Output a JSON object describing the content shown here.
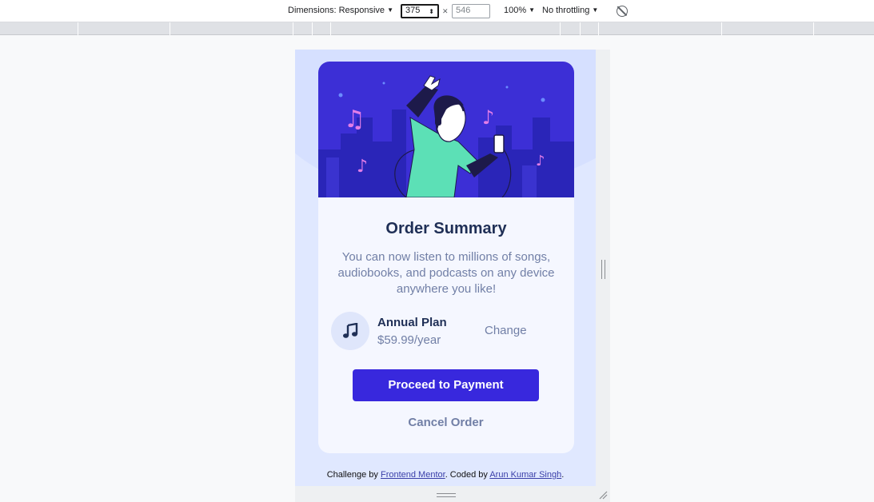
{
  "devtools": {
    "dimensions_label": "Dimensions: Responsive",
    "width_value": "375",
    "height_placeholder": "546",
    "zoom": "100%",
    "throttling": "No throttling"
  },
  "card": {
    "title": "Order Summary",
    "description": "You can now listen to millions of songs, audiobooks, and podcasts on any device anywhere you like!",
    "plan_name": "Annual Plan",
    "plan_price": "$59.99/year",
    "change_label": "Change",
    "pay_label": "Proceed to Payment",
    "cancel_label": "Cancel Order"
  },
  "attribution": {
    "prefix": "Challenge by",
    "challenge_link": "Frontend Mentor",
    "middle": ". Coded by",
    "author_link": "Arun Kumar Singh",
    "suffix": "."
  },
  "colors": {
    "hero_bg": "#3c2fd6",
    "button": "#3828dd",
    "title": "#1f2f56",
    "muted": "#717fa6",
    "page_bg": "#e0e8ff"
  }
}
